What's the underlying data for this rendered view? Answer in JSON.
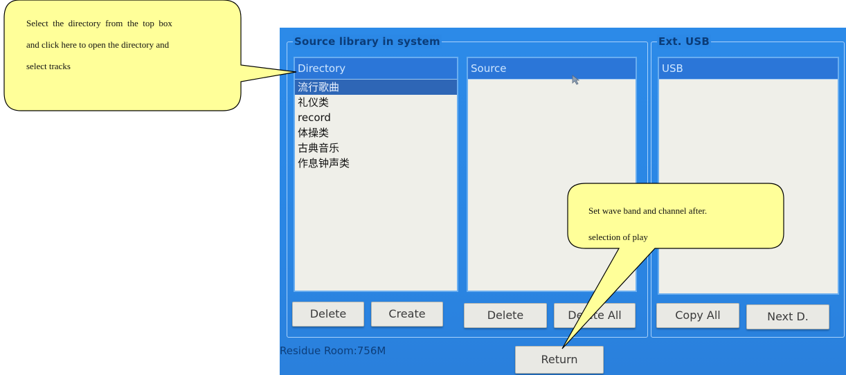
{
  "panel_source": {
    "title": "Source library in system",
    "directory": {
      "header": "Directory",
      "items": [
        "流行歌曲",
        "礼仪类",
        "record",
        "体操类",
        "古典音乐",
        "作息钟声类"
      ],
      "selected_index": 0
    },
    "source": {
      "header": "Source",
      "items": []
    },
    "buttons": {
      "delete": "Delete",
      "create": "Create",
      "delete2": "Delete",
      "delete_all": "Delete All"
    }
  },
  "panel_usb": {
    "title": "Ext. USB",
    "usb": {
      "header": "USB",
      "items": []
    },
    "buttons": {
      "copy_all": "Copy All",
      "next": "Next D."
    }
  },
  "status": {
    "residue": "Residue Room:756M"
  },
  "return_button": "Return",
  "callouts": {
    "directory": {
      "line1": "Select  the  directory  from  the  top  box",
      "line2": "and click here to open the directory and",
      "line3": "select tracks"
    },
    "return": {
      "line1": "Set wave band and channel after.",
      "line2": "selection of play"
    }
  },
  "colors": {
    "screen_blue": "#2b88e6",
    "callout_fill": "#ffff99",
    "list_bg": "#efefe9",
    "selected_row": "#2e66b6"
  }
}
